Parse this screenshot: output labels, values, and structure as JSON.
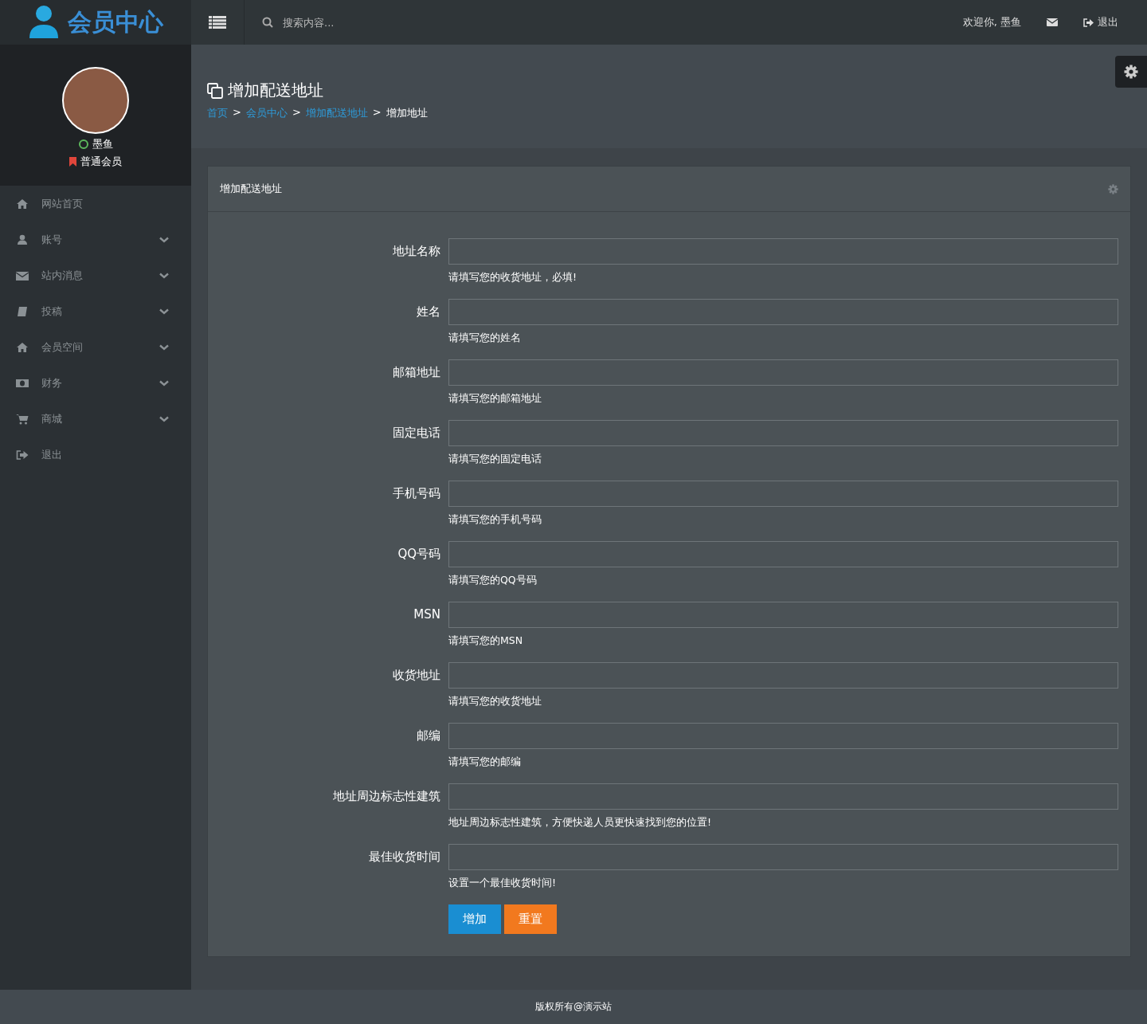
{
  "brand": {
    "title": "会员中心"
  },
  "search": {
    "placeholder": "搜索内容..."
  },
  "topbar": {
    "welcome": "欢迎你, 墨鱼",
    "logout": "退出"
  },
  "profile": {
    "name": "墨鱼",
    "online": true,
    "role": "普通会员"
  },
  "sidebar": {
    "items": [
      {
        "label": "网站首页",
        "expandable": false
      },
      {
        "label": "账号",
        "expandable": true
      },
      {
        "label": "站内消息",
        "expandable": true
      },
      {
        "label": "投稿",
        "expandable": true
      },
      {
        "label": "会员空间",
        "expandable": true
      },
      {
        "label": "财务",
        "expandable": true
      },
      {
        "label": "商城",
        "expandable": true
      },
      {
        "label": "退出",
        "expandable": false
      }
    ]
  },
  "page": {
    "title": "增加配送地址",
    "breadcrumb": [
      {
        "label": "首页",
        "link": true
      },
      {
        "label": "会员中心",
        "link": true
      },
      {
        "label": "增加配送地址",
        "link": true
      },
      {
        "label": "增加地址",
        "link": false
      }
    ],
    "separator": ">"
  },
  "panel": {
    "title": "增加配送地址"
  },
  "form": {
    "fields": [
      {
        "label": "地址名称",
        "help": "请填写您的收货地址，必填!"
      },
      {
        "label": "姓名",
        "help": "请填写您的姓名"
      },
      {
        "label": "邮箱地址",
        "help": "请填写您的邮箱地址"
      },
      {
        "label": "固定电话",
        "help": "请填写您的固定电话"
      },
      {
        "label": "手机号码",
        "help": "请填写您的手机号码"
      },
      {
        "label": "QQ号码",
        "help": "请填写您的QQ号码"
      },
      {
        "label": "MSN",
        "help": "请填写您的MSN"
      },
      {
        "label": "收货地址",
        "help": "请填写您的收货地址"
      },
      {
        "label": "邮编",
        "help": "请填写您的邮编"
      },
      {
        "label": "地址周边标志性建筑",
        "help": "地址周边标志性建筑，方便快递人员更快速找到您的位置!"
      },
      {
        "label": "最佳收货时间",
        "help": "设置一个最佳收货时间!"
      }
    ],
    "buttons": [
      {
        "label": "增加",
        "kind": "primary"
      },
      {
        "label": "重置",
        "kind": "warning"
      }
    ]
  },
  "footer": {
    "text": "版权所有@演示站"
  }
}
